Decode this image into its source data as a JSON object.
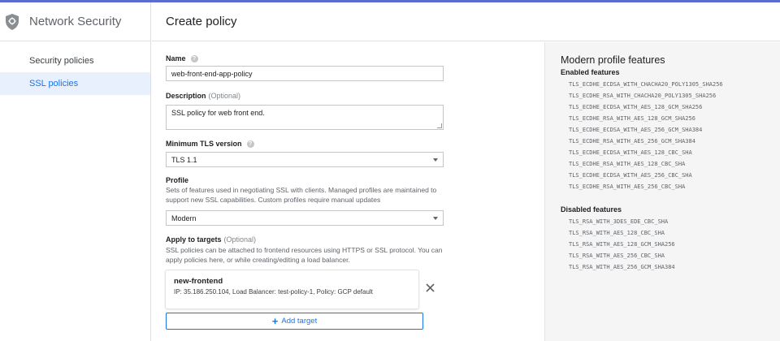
{
  "sidebar": {
    "title": "Network Security",
    "items": [
      {
        "label": "Security policies",
        "active": false
      },
      {
        "label": "SSL policies",
        "active": true
      }
    ]
  },
  "header": {
    "title": "Create policy"
  },
  "form": {
    "name": {
      "label": "Name",
      "value": "web-front-end-app-policy"
    },
    "description": {
      "label": "Description",
      "optional": "(Optional)",
      "value": "SSL policy for web front end."
    },
    "tls": {
      "label": "Minimum TLS version",
      "value": "TLS 1.1"
    },
    "profile": {
      "label": "Profile",
      "description": "Sets of features used in negotiating SSL with clients. Managed profiles are maintained to support new SSL capabilities. Custom profiles require manual updates",
      "value": "Modern"
    },
    "targets": {
      "label": "Apply to targets",
      "optional": "(Optional)",
      "description": "SSL policies can be attached to frontend resources using HTTPS or SSL protocol. You can apply policies here, or while creating/editing a load balancer.",
      "items": [
        {
          "name": "new-frontend",
          "detail": "IP: 35.186.250.104, Load Balancer: test-policy-1, Policy: GCP default"
        }
      ],
      "add_label": "Add target"
    }
  },
  "panel": {
    "title": "Modern profile features",
    "enabled_label": "Enabled features",
    "enabled": [
      "TLS_ECDHE_ECDSA_WITH_CHACHA20_POLY1305_SHA256",
      "TLS_ECDHE_RSA_WITH_CHACHA20_POLY1305_SHA256",
      "TLS_ECDHE_ECDSA_WITH_AES_128_GCM_SHA256",
      "TLS_ECDHE_RSA_WITH_AES_128_GCM_SHA256",
      "TLS_ECDHE_ECDSA_WITH_AES_256_GCM_SHA384",
      "TLS_ECDHE_RSA_WITH_AES_256_GCM_SHA384",
      "TLS_ECDHE_ECDSA_WITH_AES_128_CBC_SHA",
      "TLS_ECDHE_RSA_WITH_AES_128_CBC_SHA",
      "TLS_ECDHE_ECDSA_WITH_AES_256_CBC_SHA",
      "TLS_ECDHE_RSA_WITH_AES_256_CBC_SHA"
    ],
    "disabled_label": "Disabled features",
    "disabled": [
      "TLS_RSA_WITH_3DES_EDE_CBC_SHA",
      "TLS_RSA_WITH_AES_128_CBC_SHA",
      "TLS_RSA_WITH_AES_128_GCM_SHA256",
      "TLS_RSA_WITH_AES_256_CBC_SHA",
      "TLS_RSA_WITH_AES_256_GCM_SHA384"
    ]
  },
  "icons": {
    "app": "shield-icon",
    "help": "help-icon",
    "dropdown": "chevron-down-icon",
    "remove": "close-icon",
    "add": "plus-icon"
  },
  "colors": {
    "accent": "#1a73e8",
    "active_nav_bg": "#e8f0fe",
    "top_bar": "#5b6ed0",
    "panel_bg": "#f5f5f5"
  }
}
